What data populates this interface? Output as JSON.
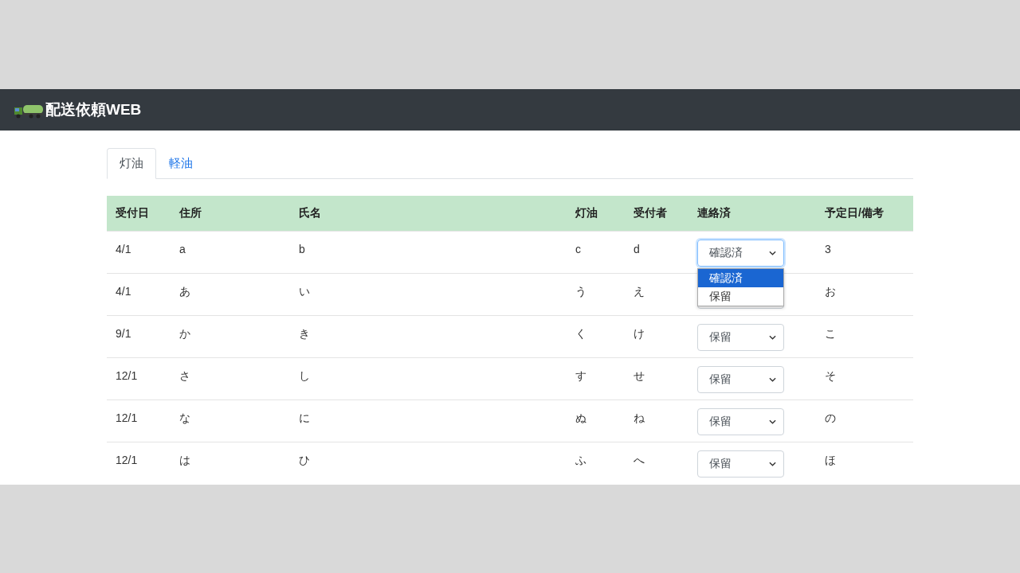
{
  "navbar": {
    "brand": "配送依頼WEB"
  },
  "tabs": [
    {
      "label": "灯油",
      "selected": true
    },
    {
      "label": "軽油",
      "selected": false
    }
  ],
  "table": {
    "columns": [
      "受付日",
      "住所",
      "氏名",
      "灯油",
      "受付者",
      "連絡済",
      "予定日/備考"
    ],
    "rows": [
      {
        "date": "4/1",
        "address": "a",
        "name": "b",
        "kerosene": "c",
        "receiver": "d",
        "status": "確認済",
        "note": "3",
        "open": true,
        "options": [
          {
            "label": "確認済",
            "selected": true
          },
          {
            "label": "保留",
            "selected": false
          }
        ]
      },
      {
        "date": "4/1",
        "address": "あ",
        "name": "い",
        "kerosene": "う",
        "receiver": "え",
        "note": "お",
        "open": false
      },
      {
        "date": "9/1",
        "address": "か",
        "name": "き",
        "kerosene": "く",
        "receiver": "け",
        "status": "保留",
        "note": "こ",
        "open": false
      },
      {
        "date": "12/1",
        "address": "さ",
        "name": "し",
        "kerosene": "す",
        "receiver": "せ",
        "status": "保留",
        "note": "そ",
        "open": false
      },
      {
        "date": "12/1",
        "address": "な",
        "name": "に",
        "kerosene": "ぬ",
        "receiver": "ね",
        "status": "保留",
        "note": "の",
        "open": false
      },
      {
        "date": "12/1",
        "address": "は",
        "name": "ひ",
        "kerosene": "ふ",
        "receiver": "へ",
        "status": "保留",
        "note": "ほ",
        "open": false
      }
    ]
  }
}
